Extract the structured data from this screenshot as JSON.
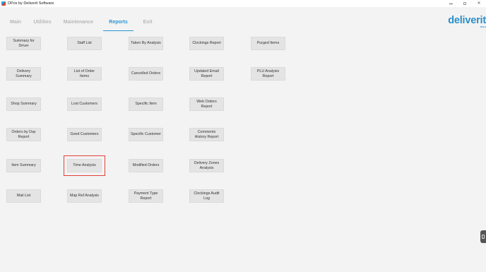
{
  "window": {
    "title": "DPos by Deliverit Software",
    "controls": {
      "minimize": "–",
      "maximize": "□",
      "close": "✕"
    }
  },
  "tabs": [
    {
      "label": "Main",
      "active": false
    },
    {
      "label": "Utilities",
      "active": false
    },
    {
      "label": "Maintenance",
      "active": false
    },
    {
      "label": "Reports",
      "active": true
    },
    {
      "label": "Exit",
      "active": false
    }
  ],
  "brand": {
    "logo_text": "deliverit",
    "logo_subtext": "SOLU",
    "color": "#2b8fc9"
  },
  "colors": {
    "accent": "#2b97d2",
    "highlight": "#e0413b",
    "button_bg": "#e4e4e4"
  },
  "reports": {
    "summary_for_driver": "Summary for Driver",
    "staff_list": "Staff List",
    "taken_by_analysis": "Taken By Analysis",
    "clockings_report": "Clockings Report",
    "purged_items": "Purged Items",
    "delivery_summary": "Delivery Summary",
    "list_of_order_items": "List of Order Items",
    "cancelled_orders": "Cancelled Orders",
    "updated_email_report": "Updated Email Report",
    "plu_analysis_report": "PLU Analysis Report",
    "shop_summary": "Shop Summary",
    "lost_customers": "Lost Customers",
    "specific_item": "Specific Item",
    "web_orders_report": "Web Orders Report",
    "orders_by_day_report": "Orders by Day Report",
    "good_customers": "Good Customers",
    "specific_customer": "Specific Customer",
    "comments_history_report": "Comments History Report",
    "item_summary": "Item Summary",
    "time_analysis": "Time Analysis",
    "modified_orders": "Modified Orders",
    "delivery_zones_analysis": "Delivery Zones Analysis",
    "mail_list": "Mail List",
    "map_ref_analysis": "Map Ref Analysis",
    "payment_type_report": "Payment Type Report",
    "clockings_audit_log": "Clockings Audit Log"
  }
}
